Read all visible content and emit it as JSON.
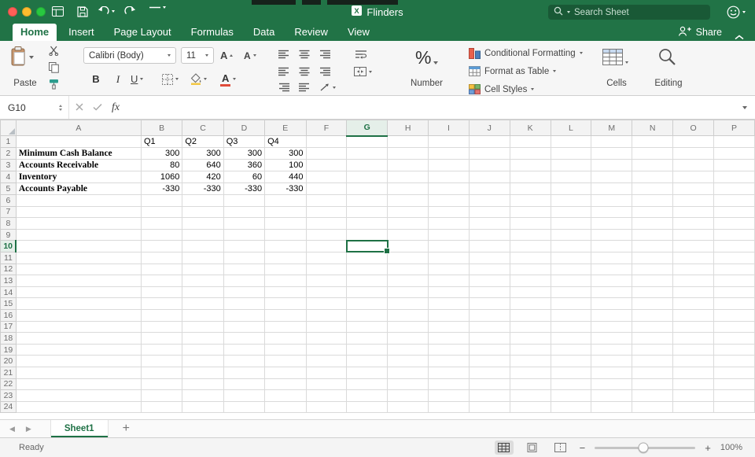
{
  "colors": {
    "brand_green": "#217346",
    "selection_green": "#1e7145",
    "negative_red": "#e04b3a"
  },
  "titlebar": {
    "title": "Flinders",
    "search_placeholder": "Search Sheet"
  },
  "ribbon_tabs": {
    "tabs": [
      {
        "label": "Home",
        "active": true
      },
      {
        "label": "Insert"
      },
      {
        "label": "Page Layout"
      },
      {
        "label": "Formulas"
      },
      {
        "label": "Data"
      },
      {
        "label": "Review"
      },
      {
        "label": "View"
      }
    ],
    "share_label": "Share"
  },
  "ribbon": {
    "paste_label": "Paste",
    "font_name": "Calibri (Body)",
    "font_size": "11",
    "bold": "B",
    "italic": "I",
    "underline": "U",
    "grow_font": "A",
    "shrink_font": "A",
    "font_color": "A",
    "number_group": {
      "percent": "%",
      "label": "Number"
    },
    "styles_group": {
      "conditional_formatting": "Conditional Formatting",
      "format_as_table": "Format as Table",
      "cell_styles": "Cell Styles"
    },
    "cells_label": "Cells",
    "editing_label": "Editing"
  },
  "formula_bar": {
    "cell_reference": "G10",
    "fx_label": "fx"
  },
  "grid": {
    "column_letters": [
      "A",
      "B",
      "C",
      "D",
      "E",
      "F",
      "G",
      "H",
      "I",
      "J",
      "K",
      "L",
      "M",
      "N",
      "O",
      "P"
    ],
    "row_count": 24,
    "selected": {
      "col": "G",
      "row": 10
    },
    "cells": {
      "B1": "Q1",
      "C1": "Q2",
      "D1": "Q3",
      "E1": "Q4",
      "A2": "Minimum Cash Balance",
      "B2": "300",
      "C2": "300",
      "D2": "300",
      "E2": "300",
      "A3": "Accounts Receivable",
      "B3": "80",
      "C3": "640",
      "D3": "360",
      "E3": "100",
      "A4": "Inventory",
      "B4": "1060",
      "C4": "420",
      "D4": "60",
      "E4": "440",
      "A5": "Accounts Payable",
      "B5": "-330",
      "C5": "-330",
      "D5": "-330",
      "E5": "-330"
    },
    "bold_label_cells": [
      "A2",
      "A3",
      "A4",
      "A5"
    ]
  },
  "sheet_bar": {
    "prev_arrow": "◀",
    "next_arrow": "▶",
    "active_sheet": "Sheet1",
    "add_label": "+"
  },
  "status_bar": {
    "status": "Ready",
    "zoom_out": "−",
    "zoom_in": "+",
    "zoom": "100%"
  },
  "icons": {
    "titlebar": [
      "window-grid-icon",
      "save-icon",
      "undo-icon",
      "redo-icon",
      "toolbar-options-icon",
      "excel-doc-icon",
      "search-icon",
      "smiley-icon"
    ],
    "ribbon": [
      "paste-clipboard-icon",
      "cut-scissors-icon",
      "copy-icon",
      "format-painter-icon",
      "borders-icon",
      "fill-color-icon",
      "font-color-icon",
      "align-line-icons",
      "wrap-text-icon",
      "merge-cells-icon",
      "conditional-formatting-icon",
      "format-as-table-icon",
      "cell-styles-icon",
      "cells-icon",
      "editing-search-icon"
    ],
    "statusbar": [
      "normal-view-icon",
      "page-layout-view-icon",
      "page-break-view-icon"
    ]
  }
}
